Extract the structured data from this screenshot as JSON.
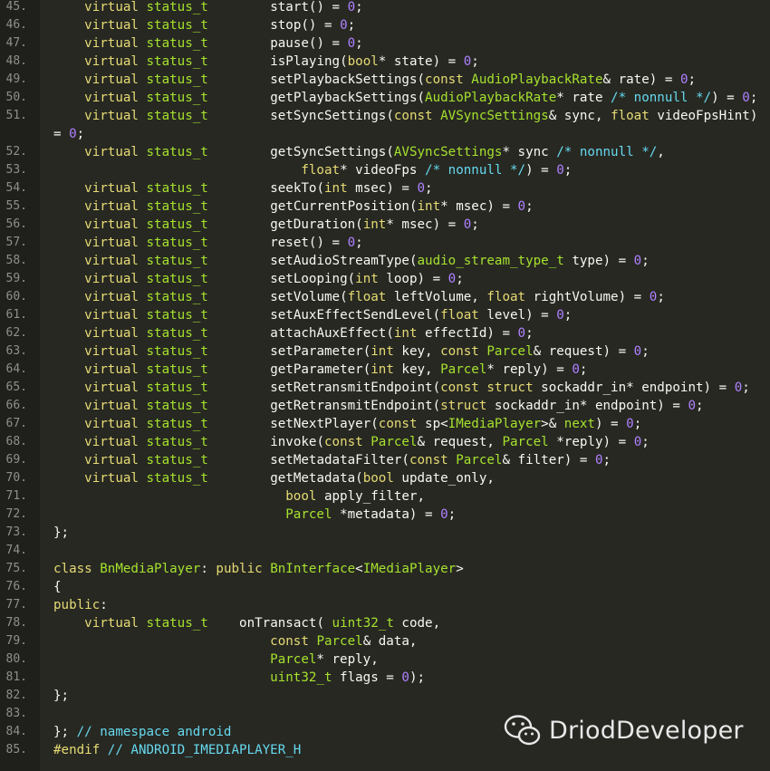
{
  "colors": {
    "background": "#272822",
    "gutter": "#1f201b",
    "line_number": "#8f908a",
    "keyword": "#e6db74",
    "type_green": "#a6e22e",
    "type_blue": "#66d9ef",
    "number": "#ae81ff",
    "comment": "#66d9ef",
    "default": "#f8f8f2"
  },
  "lines": [
    {
      "n": "45.",
      "seg": [
        [
          "    ",
          "df"
        ],
        [
          "virtual",
          "kw"
        ],
        [
          " ",
          "df"
        ],
        [
          "status_t",
          "ty"
        ],
        [
          "        start() = ",
          "df"
        ],
        [
          "0",
          "nm"
        ],
        [
          ";",
          "df"
        ]
      ]
    },
    {
      "n": "46.",
      "seg": [
        [
          "    ",
          "df"
        ],
        [
          "virtual",
          "kw"
        ],
        [
          " ",
          "df"
        ],
        [
          "status_t",
          "ty"
        ],
        [
          "        stop() = ",
          "df"
        ],
        [
          "0",
          "nm"
        ],
        [
          ";",
          "df"
        ]
      ]
    },
    {
      "n": "47.",
      "seg": [
        [
          "    ",
          "df"
        ],
        [
          "virtual",
          "kw"
        ],
        [
          " ",
          "df"
        ],
        [
          "status_t",
          "ty"
        ],
        [
          "        pause() = ",
          "df"
        ],
        [
          "0",
          "nm"
        ],
        [
          ";",
          "df"
        ]
      ]
    },
    {
      "n": "48.",
      "seg": [
        [
          "    ",
          "df"
        ],
        [
          "virtual",
          "kw"
        ],
        [
          " ",
          "df"
        ],
        [
          "status_t",
          "ty"
        ],
        [
          "        isPlaying(",
          "df"
        ],
        [
          "bool",
          "kw"
        ],
        [
          "* state) = ",
          "df"
        ],
        [
          "0",
          "nm"
        ],
        [
          ";",
          "df"
        ]
      ]
    },
    {
      "n": "49.",
      "seg": [
        [
          "    ",
          "df"
        ],
        [
          "virtual",
          "kw"
        ],
        [
          " ",
          "df"
        ],
        [
          "status_t",
          "ty"
        ],
        [
          "        setPlaybackSettings(",
          "df"
        ],
        [
          "const",
          "kw"
        ],
        [
          " ",
          "df"
        ],
        [
          "AudioPlaybackRate",
          "ty"
        ],
        [
          "& rate) = ",
          "df"
        ],
        [
          "0",
          "nm"
        ],
        [
          ";",
          "df"
        ]
      ]
    },
    {
      "n": "50.",
      "seg": [
        [
          "    ",
          "df"
        ],
        [
          "virtual",
          "kw"
        ],
        [
          " ",
          "df"
        ],
        [
          "status_t",
          "ty"
        ],
        [
          "        getPlaybackSettings(",
          "df"
        ],
        [
          "AudioPlaybackRate",
          "ty"
        ],
        [
          "* rate ",
          "df"
        ],
        [
          "/* nonnull */",
          "cm"
        ],
        [
          ") = ",
          "df"
        ],
        [
          "0",
          "nm"
        ],
        [
          ";",
          "df"
        ]
      ]
    },
    {
      "n": "51.",
      "seg": [
        [
          "    ",
          "df"
        ],
        [
          "virtual",
          "kw"
        ],
        [
          " ",
          "df"
        ],
        [
          "status_t",
          "ty"
        ],
        [
          "        setSyncSettings(",
          "df"
        ],
        [
          "const",
          "kw"
        ],
        [
          " ",
          "df"
        ],
        [
          "AVSyncSettings",
          "ty"
        ],
        [
          "& sync, ",
          "df"
        ],
        [
          "float",
          "kw"
        ],
        [
          " videoFpsHint)",
          "df"
        ]
      ]
    },
    {
      "n": "",
      "seg": [
        [
          "= ",
          "df"
        ],
        [
          "0",
          "nm"
        ],
        [
          ";",
          "df"
        ]
      ]
    },
    {
      "n": "52.",
      "seg": [
        [
          "    ",
          "df"
        ],
        [
          "virtual",
          "kw"
        ],
        [
          " ",
          "df"
        ],
        [
          "status_t",
          "ty"
        ],
        [
          "        getSyncSettings(",
          "df"
        ],
        [
          "AVSyncSettings",
          "ty"
        ],
        [
          "* sync ",
          "df"
        ],
        [
          "/* nonnull */",
          "cm"
        ],
        [
          ",",
          "df"
        ]
      ]
    },
    {
      "n": "53.",
      "seg": [
        [
          "                                ",
          "df"
        ],
        [
          "float",
          "kw"
        ],
        [
          "* videoFps ",
          "df"
        ],
        [
          "/* nonnull */",
          "cm"
        ],
        [
          ") = ",
          "df"
        ],
        [
          "0",
          "nm"
        ],
        [
          ";",
          "df"
        ]
      ]
    },
    {
      "n": "54.",
      "seg": [
        [
          "    ",
          "df"
        ],
        [
          "virtual",
          "kw"
        ],
        [
          " ",
          "df"
        ],
        [
          "status_t",
          "ty"
        ],
        [
          "        seekTo(",
          "df"
        ],
        [
          "int",
          "kw"
        ],
        [
          " msec) = ",
          "df"
        ],
        [
          "0",
          "nm"
        ],
        [
          ";",
          "df"
        ]
      ]
    },
    {
      "n": "55.",
      "seg": [
        [
          "    ",
          "df"
        ],
        [
          "virtual",
          "kw"
        ],
        [
          " ",
          "df"
        ],
        [
          "status_t",
          "ty"
        ],
        [
          "        getCurrentPosition(",
          "df"
        ],
        [
          "int",
          "kw"
        ],
        [
          "* msec) = ",
          "df"
        ],
        [
          "0",
          "nm"
        ],
        [
          ";",
          "df"
        ]
      ]
    },
    {
      "n": "56.",
      "seg": [
        [
          "    ",
          "df"
        ],
        [
          "virtual",
          "kw"
        ],
        [
          " ",
          "df"
        ],
        [
          "status_t",
          "ty"
        ],
        [
          "        getDuration(",
          "df"
        ],
        [
          "int",
          "kw"
        ],
        [
          "* msec) = ",
          "df"
        ],
        [
          "0",
          "nm"
        ],
        [
          ";",
          "df"
        ]
      ]
    },
    {
      "n": "57.",
      "seg": [
        [
          "    ",
          "df"
        ],
        [
          "virtual",
          "kw"
        ],
        [
          " ",
          "df"
        ],
        [
          "status_t",
          "ty"
        ],
        [
          "        reset() = ",
          "df"
        ],
        [
          "0",
          "nm"
        ],
        [
          ";",
          "df"
        ]
      ]
    },
    {
      "n": "58.",
      "seg": [
        [
          "    ",
          "df"
        ],
        [
          "virtual",
          "kw"
        ],
        [
          " ",
          "df"
        ],
        [
          "status_t",
          "ty"
        ],
        [
          "        setAudioStreamType(",
          "df"
        ],
        [
          "audio_stream_type_t",
          "ty"
        ],
        [
          " type) = ",
          "df"
        ],
        [
          "0",
          "nm"
        ],
        [
          ";",
          "df"
        ]
      ]
    },
    {
      "n": "59.",
      "seg": [
        [
          "    ",
          "df"
        ],
        [
          "virtual",
          "kw"
        ],
        [
          " ",
          "df"
        ],
        [
          "status_t",
          "ty"
        ],
        [
          "        setLooping(",
          "df"
        ],
        [
          "int",
          "kw"
        ],
        [
          " loop) = ",
          "df"
        ],
        [
          "0",
          "nm"
        ],
        [
          ";",
          "df"
        ]
      ]
    },
    {
      "n": "60.",
      "seg": [
        [
          "    ",
          "df"
        ],
        [
          "virtual",
          "kw"
        ],
        [
          " ",
          "df"
        ],
        [
          "status_t",
          "ty"
        ],
        [
          "        setVolume(",
          "df"
        ],
        [
          "float",
          "kw"
        ],
        [
          " leftVolume, ",
          "df"
        ],
        [
          "float",
          "kw"
        ],
        [
          " rightVolume) = ",
          "df"
        ],
        [
          "0",
          "nm"
        ],
        [
          ";",
          "df"
        ]
      ]
    },
    {
      "n": "61.",
      "seg": [
        [
          "    ",
          "df"
        ],
        [
          "virtual",
          "kw"
        ],
        [
          " ",
          "df"
        ],
        [
          "status_t",
          "ty"
        ],
        [
          "        setAuxEffectSendLevel(",
          "df"
        ],
        [
          "float",
          "kw"
        ],
        [
          " level) = ",
          "df"
        ],
        [
          "0",
          "nm"
        ],
        [
          ";",
          "df"
        ]
      ]
    },
    {
      "n": "62.",
      "seg": [
        [
          "    ",
          "df"
        ],
        [
          "virtual",
          "kw"
        ],
        [
          " ",
          "df"
        ],
        [
          "status_t",
          "ty"
        ],
        [
          "        attachAuxEffect(",
          "df"
        ],
        [
          "int",
          "kw"
        ],
        [
          " effectId) = ",
          "df"
        ],
        [
          "0",
          "nm"
        ],
        [
          ";",
          "df"
        ]
      ]
    },
    {
      "n": "63.",
      "seg": [
        [
          "    ",
          "df"
        ],
        [
          "virtual",
          "kw"
        ],
        [
          " ",
          "df"
        ],
        [
          "status_t",
          "ty"
        ],
        [
          "        setParameter(",
          "df"
        ],
        [
          "int",
          "kw"
        ],
        [
          " key, ",
          "df"
        ],
        [
          "const",
          "kw"
        ],
        [
          " ",
          "df"
        ],
        [
          "Parcel",
          "ty"
        ],
        [
          "& request) = ",
          "df"
        ],
        [
          "0",
          "nm"
        ],
        [
          ";",
          "df"
        ]
      ]
    },
    {
      "n": "64.",
      "seg": [
        [
          "    ",
          "df"
        ],
        [
          "virtual",
          "kw"
        ],
        [
          " ",
          "df"
        ],
        [
          "status_t",
          "ty"
        ],
        [
          "        getParameter(",
          "df"
        ],
        [
          "int",
          "kw"
        ],
        [
          " key, ",
          "df"
        ],
        [
          "Parcel",
          "ty"
        ],
        [
          "* reply) = ",
          "df"
        ],
        [
          "0",
          "nm"
        ],
        [
          ";",
          "df"
        ]
      ]
    },
    {
      "n": "65.",
      "seg": [
        [
          "    ",
          "df"
        ],
        [
          "virtual",
          "kw"
        ],
        [
          " ",
          "df"
        ],
        [
          "status_t",
          "ty"
        ],
        [
          "        setRetransmitEndpoint(",
          "df"
        ],
        [
          "const",
          "kw"
        ],
        [
          " ",
          "df"
        ],
        [
          "struct",
          "kw"
        ],
        [
          " sockaddr_in* endpoint) = ",
          "df"
        ],
        [
          "0",
          "nm"
        ],
        [
          ";",
          "df"
        ]
      ]
    },
    {
      "n": "66.",
      "seg": [
        [
          "    ",
          "df"
        ],
        [
          "virtual",
          "kw"
        ],
        [
          " ",
          "df"
        ],
        [
          "status_t",
          "ty"
        ],
        [
          "        getRetransmitEndpoint(",
          "df"
        ],
        [
          "struct",
          "kw"
        ],
        [
          " sockaddr_in* endpoint) = ",
          "df"
        ],
        [
          "0",
          "nm"
        ],
        [
          ";",
          "df"
        ]
      ]
    },
    {
      "n": "67.",
      "seg": [
        [
          "    ",
          "df"
        ],
        [
          "virtual",
          "kw"
        ],
        [
          " ",
          "df"
        ],
        [
          "status_t",
          "ty"
        ],
        [
          "        setNextPlayer(",
          "df"
        ],
        [
          "const",
          "kw"
        ],
        [
          " sp<",
          "df"
        ],
        [
          "IMediaPlayer",
          "ty"
        ],
        [
          ">& ",
          "df"
        ],
        [
          "next",
          "ty"
        ],
        [
          ") = ",
          "df"
        ],
        [
          "0",
          "nm"
        ],
        [
          ";",
          "df"
        ]
      ]
    },
    {
      "n": "68.",
      "seg": [
        [
          "    ",
          "df"
        ],
        [
          "virtual",
          "kw"
        ],
        [
          " ",
          "df"
        ],
        [
          "status_t",
          "ty"
        ],
        [
          "        invoke(",
          "df"
        ],
        [
          "const",
          "kw"
        ],
        [
          " ",
          "df"
        ],
        [
          "Parcel",
          "ty"
        ],
        [
          "& request, ",
          "df"
        ],
        [
          "Parcel",
          "ty"
        ],
        [
          " *reply) = ",
          "df"
        ],
        [
          "0",
          "nm"
        ],
        [
          ";",
          "df"
        ]
      ]
    },
    {
      "n": "69.",
      "seg": [
        [
          "    ",
          "df"
        ],
        [
          "virtual",
          "kw"
        ],
        [
          " ",
          "df"
        ],
        [
          "status_t",
          "ty"
        ],
        [
          "        setMetadataFilter(",
          "df"
        ],
        [
          "const",
          "kw"
        ],
        [
          " ",
          "df"
        ],
        [
          "Parcel",
          "ty"
        ],
        [
          "& filter) = ",
          "df"
        ],
        [
          "0",
          "nm"
        ],
        [
          ";",
          "df"
        ]
      ]
    },
    {
      "n": "70.",
      "seg": [
        [
          "    ",
          "df"
        ],
        [
          "virtual",
          "kw"
        ],
        [
          " ",
          "df"
        ],
        [
          "status_t",
          "ty"
        ],
        [
          "        getMetadata(",
          "df"
        ],
        [
          "bool",
          "kw"
        ],
        [
          " update_only,",
          "df"
        ]
      ]
    },
    {
      "n": "71.",
      "seg": [
        [
          "                              ",
          "df"
        ],
        [
          "bool",
          "kw"
        ],
        [
          " apply_filter,",
          "df"
        ]
      ]
    },
    {
      "n": "72.",
      "seg": [
        [
          "                              ",
          "df"
        ],
        [
          "Parcel",
          "ty"
        ],
        [
          " *metadata) = ",
          "df"
        ],
        [
          "0",
          "nm"
        ],
        [
          ";",
          "df"
        ]
      ]
    },
    {
      "n": "73.",
      "seg": [
        [
          "};",
          "df"
        ]
      ]
    },
    {
      "n": "74.",
      "seg": []
    },
    {
      "n": "75.",
      "seg": [
        [
          "class",
          "kw"
        ],
        [
          " ",
          "df"
        ],
        [
          "BnMediaPlayer",
          "ty"
        ],
        [
          ": ",
          "df"
        ],
        [
          "public",
          "kw"
        ],
        [
          " ",
          "df"
        ],
        [
          "BnInterface",
          "ty"
        ],
        [
          "<",
          "df"
        ],
        [
          "IMediaPlayer",
          "ty"
        ],
        [
          ">",
          "df"
        ]
      ]
    },
    {
      "n": "76.",
      "seg": [
        [
          "{",
          "df"
        ]
      ]
    },
    {
      "n": "77.",
      "seg": [
        [
          "public",
          "kw"
        ],
        [
          ":",
          "df"
        ]
      ]
    },
    {
      "n": "78.",
      "seg": [
        [
          "    ",
          "df"
        ],
        [
          "virtual",
          "kw"
        ],
        [
          " ",
          "df"
        ],
        [
          "status_t",
          "ty"
        ],
        [
          "    onTransact( ",
          "df"
        ],
        [
          "uint32_t",
          "ty"
        ],
        [
          " code,",
          "df"
        ]
      ]
    },
    {
      "n": "79.",
      "seg": [
        [
          "                            ",
          "df"
        ],
        [
          "const",
          "kw"
        ],
        [
          " ",
          "df"
        ],
        [
          "Parcel",
          "ty"
        ],
        [
          "& data,",
          "df"
        ]
      ]
    },
    {
      "n": "80.",
      "seg": [
        [
          "                            ",
          "df"
        ],
        [
          "Parcel",
          "ty"
        ],
        [
          "* reply,",
          "df"
        ]
      ]
    },
    {
      "n": "81.",
      "seg": [
        [
          "                            ",
          "df"
        ],
        [
          "uint32_t",
          "ty"
        ],
        [
          " flags = ",
          "df"
        ],
        [
          "0",
          "nm"
        ],
        [
          ");",
          "df"
        ]
      ]
    },
    {
      "n": "82.",
      "seg": [
        [
          "};",
          "df"
        ]
      ]
    },
    {
      "n": "83.",
      "seg": []
    },
    {
      "n": "84.",
      "seg": [
        [
          "}; ",
          "df"
        ],
        [
          "// namespace android",
          "cm"
        ]
      ]
    },
    {
      "n": "85.",
      "seg": [
        [
          "#endif",
          "kw"
        ],
        [
          " ",
          "df"
        ],
        [
          "// ANDROID_IMEDIAPLAYER_H",
          "cm"
        ]
      ]
    }
  ],
  "watermark": {
    "text": "DriodDeveloper",
    "icon": "wechat-logo-icon"
  }
}
